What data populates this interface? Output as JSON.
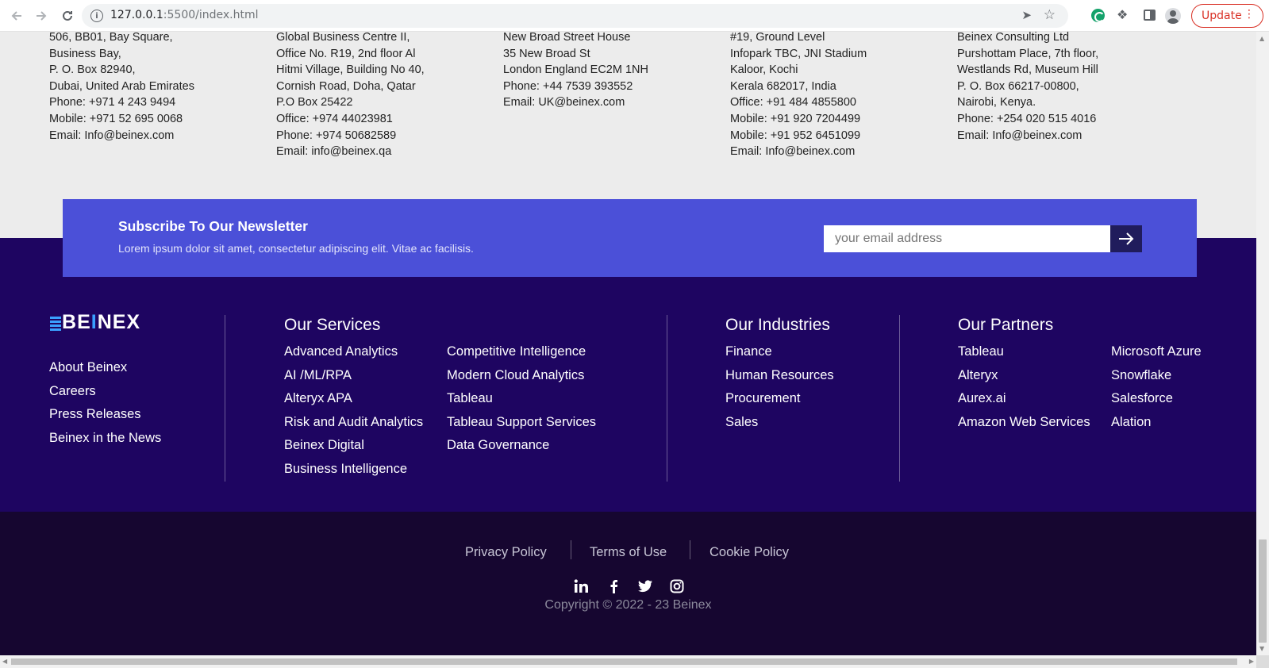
{
  "browser": {
    "url_host": "127.0.0.1",
    "url_path": ":5500/index.html",
    "update_label": "Update"
  },
  "offices": [
    [
      "506, BB01, Bay Square,",
      "Business Bay,",
      "P. O. Box 82940,",
      "Dubai, United Arab Emirates",
      "Phone: +971 4 243 9494",
      "Mobile: +971 52 695 0068",
      "Email: Info@beinex.com"
    ],
    [
      "Global Business Centre II,",
      "Office No. R19, 2nd floor Al",
      "Hitmi Village, Building No 40,",
      "Cornish Road, Doha, Qatar",
      "P.O Box 25422",
      "Office: +974 44023981",
      "Phone: +974 50682589",
      "Email: info@beinex.qa"
    ],
    [
      "New Broad Street House",
      "35 New Broad St",
      "London England EC2M 1NH",
      "Phone: +44 7539 393552",
      "Email: UK@beinex.com"
    ],
    [
      "#19, Ground Level",
      "Infopark TBC, JNI Stadium",
      "Kaloor, Kochi",
      "Kerala 682017, India",
      "Office: +91 484 4855800",
      "Mobile: +91 920 7204499",
      "Mobile: +91 952 6451099",
      "Email: Info@beinex.com"
    ],
    [
      "Beinex Consulting Ltd",
      "Purshottam Place, 7th floor,",
      "Westlands Rd, Museum Hill",
      "P. O. Box 66217-00800,",
      "Nairobi, Kenya.",
      "Phone: +254 020 515 4016",
      "Email: Info@beinex.com"
    ]
  ],
  "newsletter": {
    "title": "Subscribe To Our Newsletter",
    "description": "Lorem ipsum dolor sit amet, consectetur adipiscing elit. Vitae ac facilisis.",
    "placeholder": "your email address"
  },
  "logo": {
    "b": "B",
    "e": "E",
    "i": "I",
    "nex": "NEX"
  },
  "company_links": [
    "About Beinex",
    "Careers",
    "Press Releases",
    "Beinex in the News"
  ],
  "services": {
    "heading": "Our Services",
    "col1": [
      "Advanced Analytics",
      "AI /ML/RPA",
      "Alteryx APA",
      "Risk and Audit Analytics",
      "Beinex Digital",
      "Business Intelligence"
    ],
    "col2": [
      "Competitive Intelligence",
      "Modern Cloud Analytics",
      "Tableau",
      "Tableau Support Services",
      "Data Governance"
    ]
  },
  "industries": {
    "heading": "Our Industries",
    "items": [
      "Finance",
      "Human Resources",
      "Procurement",
      "Sales"
    ]
  },
  "partners": {
    "heading": "Our Partners",
    "col1": [
      "Tableau",
      "Alteryx",
      "Aurex.ai",
      "Amazon Web Services"
    ],
    "col2": [
      "Microsoft Azure",
      "Snowflake",
      "Salesforce",
      "Alation"
    ]
  },
  "legal": [
    "Privacy Policy",
    "Terms of Use",
    "Cookie Policy"
  ],
  "social_icons": [
    "linkedin-icon",
    "facebook-icon",
    "twitter-icon",
    "instagram-icon"
  ],
  "copyright": "Copyright © 2022 - 23 Beinex",
  "colors": {
    "footer_bg": "#1e0561",
    "newsletter_bg": "#4b50d8",
    "bottom_bg": "#160630",
    "address_bg": "#ececec",
    "logo_accent": "#3aa0ff"
  }
}
